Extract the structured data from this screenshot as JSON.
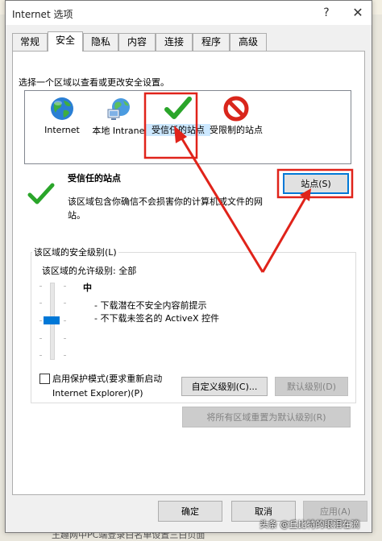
{
  "window": {
    "title": "Internet 选项",
    "help_glyph": "?",
    "close_glyph": "✕"
  },
  "tabs": [
    {
      "label": "常规",
      "active": false
    },
    {
      "label": "安全",
      "active": true
    },
    {
      "label": "隐私",
      "active": false
    },
    {
      "label": "内容",
      "active": false
    },
    {
      "label": "连接",
      "active": false
    },
    {
      "label": "程序",
      "active": false
    },
    {
      "label": "高级",
      "active": false
    }
  ],
  "security": {
    "zone_caption": "选择一个区域以查看或更改安全设置。",
    "zones": [
      {
        "label": "Internet",
        "icon": "globe-icon"
      },
      {
        "label": "本地 Intranet",
        "icon": "network-globe-icon"
      },
      {
        "label": "受信任的站点",
        "icon": "green-check-icon",
        "selected": true
      },
      {
        "label": "受限制的站点",
        "icon": "prohibited-icon"
      }
    ],
    "selected_zone": {
      "title": "受信任的站点",
      "description": "该区域包含你确信不会损害你的计算机或文件的网站。",
      "sites_button": "站点(S)"
    },
    "level_group": {
      "title": "该区域的安全级别(L)",
      "allowed": "该区域的允许级别: 全部",
      "level_name": "中",
      "level_desc": [
        "- 下载潜在不安全内容前提示",
        "- 不下载未签名的 ActiveX 控件"
      ],
      "slider_level": 0.5,
      "protected_mode_label": "启用保护模式(要求重新启动 Internet Explorer)(P)",
      "protected_mode_checked": false,
      "custom_level_button": "自定义级别(C)...",
      "default_level_button": "默认级别(D)"
    },
    "reset_all_button": "将所有区域重置为默认级别(R)"
  },
  "footer": {
    "ok": "确定",
    "cancel": "取消",
    "apply": "应用(A)"
  },
  "watermark": "头条 @丘比特的眼泪在滴",
  "background_text": "王趣网中PC端登录白名单设置三白页面"
}
